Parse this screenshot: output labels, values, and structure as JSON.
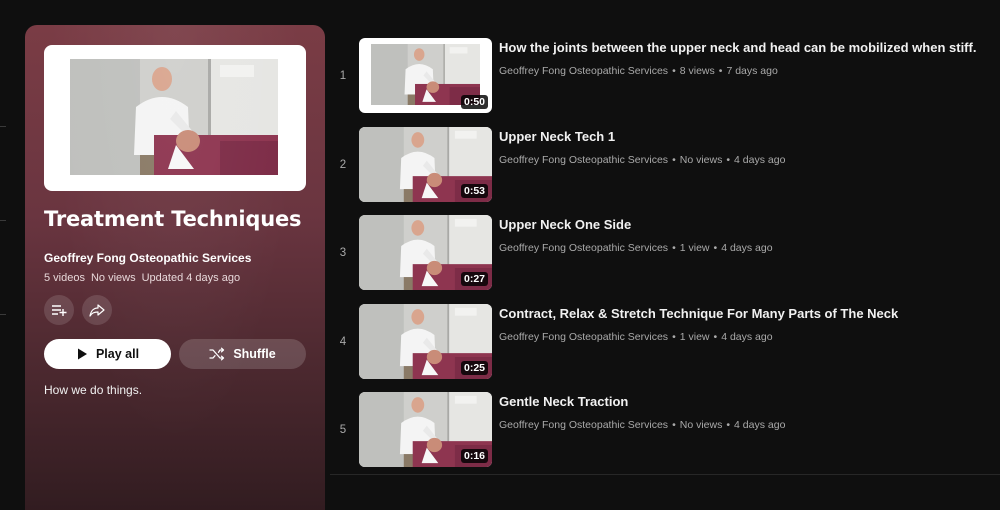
{
  "playlist": {
    "title": "Treatment Techniques",
    "channel": "Geoffrey Fong Osteopathic Services",
    "video_count": "5 videos",
    "views": "No views",
    "updated": "Updated 4 days ago",
    "play_all_label": "Play all",
    "shuffle_label": "Shuffle",
    "description": "How we do things.",
    "icons": {
      "save": "playlist-add-icon",
      "share": "share-icon",
      "play": "play-icon",
      "shuffle": "shuffle-icon"
    }
  },
  "videos": [
    {
      "index": "1",
      "title": "How the joints between the upper neck and head can be mobilized when stiff.",
      "channel": "Geoffrey Fong Osteopathic Services",
      "views": "8 views",
      "age": "7 days ago",
      "duration": "0:50"
    },
    {
      "index": "2",
      "title": "Upper Neck Tech 1",
      "channel": "Geoffrey Fong Osteopathic Services",
      "views": "No views",
      "age": "4 days ago",
      "duration": "0:53"
    },
    {
      "index": "3",
      "title": "Upper Neck One Side",
      "channel": "Geoffrey Fong Osteopathic Services",
      "views": "1 view",
      "age": "4 days ago",
      "duration": "0:27"
    },
    {
      "index": "4",
      "title": "Contract, Relax & Stretch Technique For Many Parts of The Neck",
      "channel": "Geoffrey Fong Osteopathic Services",
      "views": "1 view",
      "age": "4 days ago",
      "duration": "0:25"
    },
    {
      "index": "5",
      "title": "Gentle Neck Traction",
      "channel": "Geoffrey Fong Osteopathic Services",
      "views": "No views",
      "age": "4 days ago",
      "duration": "0:16"
    }
  ],
  "colors": {
    "background": "#0f0f0f",
    "panel_top": "#7a3c45",
    "panel_bottom": "#2f1b1f",
    "secondary_text": "#aaaaaa"
  }
}
